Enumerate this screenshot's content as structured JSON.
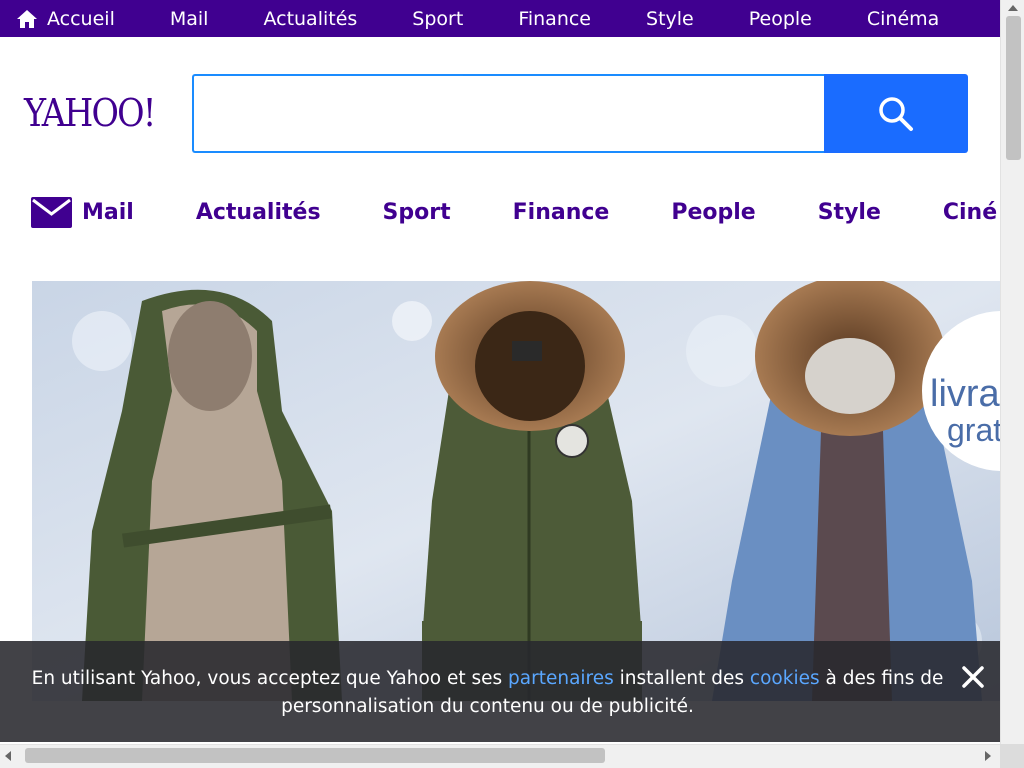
{
  "topbar": {
    "items": [
      {
        "label": "Accueil"
      },
      {
        "label": "Mail"
      },
      {
        "label": "Actualités"
      },
      {
        "label": "Sport"
      },
      {
        "label": "Finance"
      },
      {
        "label": "Style"
      },
      {
        "label": "People"
      },
      {
        "label": "Cinéma"
      }
    ]
  },
  "logo": {
    "text": "YAHOO!"
  },
  "search": {
    "placeholder": "",
    "value": ""
  },
  "nav": {
    "items": [
      {
        "label": "Mail"
      },
      {
        "label": "Actualités"
      },
      {
        "label": "Sport"
      },
      {
        "label": "Finance"
      },
      {
        "label": "People"
      },
      {
        "label": "Style"
      },
      {
        "label": "Ciné"
      }
    ]
  },
  "ad": {
    "badge_line1": "livra",
    "badge_line2": "grat"
  },
  "cookie": {
    "text_before": "En utilisant Yahoo, vous acceptez que Yahoo et ses ",
    "link_partners": "partenaires",
    "text_middle": " installent des ",
    "link_cookies": "cookies",
    "text_after": " à des fins de personnalisation du contenu ou de publicité."
  },
  "colors": {
    "brand": "#400090",
    "search_button": "#1a6cff",
    "link": "#5aa7ff"
  }
}
